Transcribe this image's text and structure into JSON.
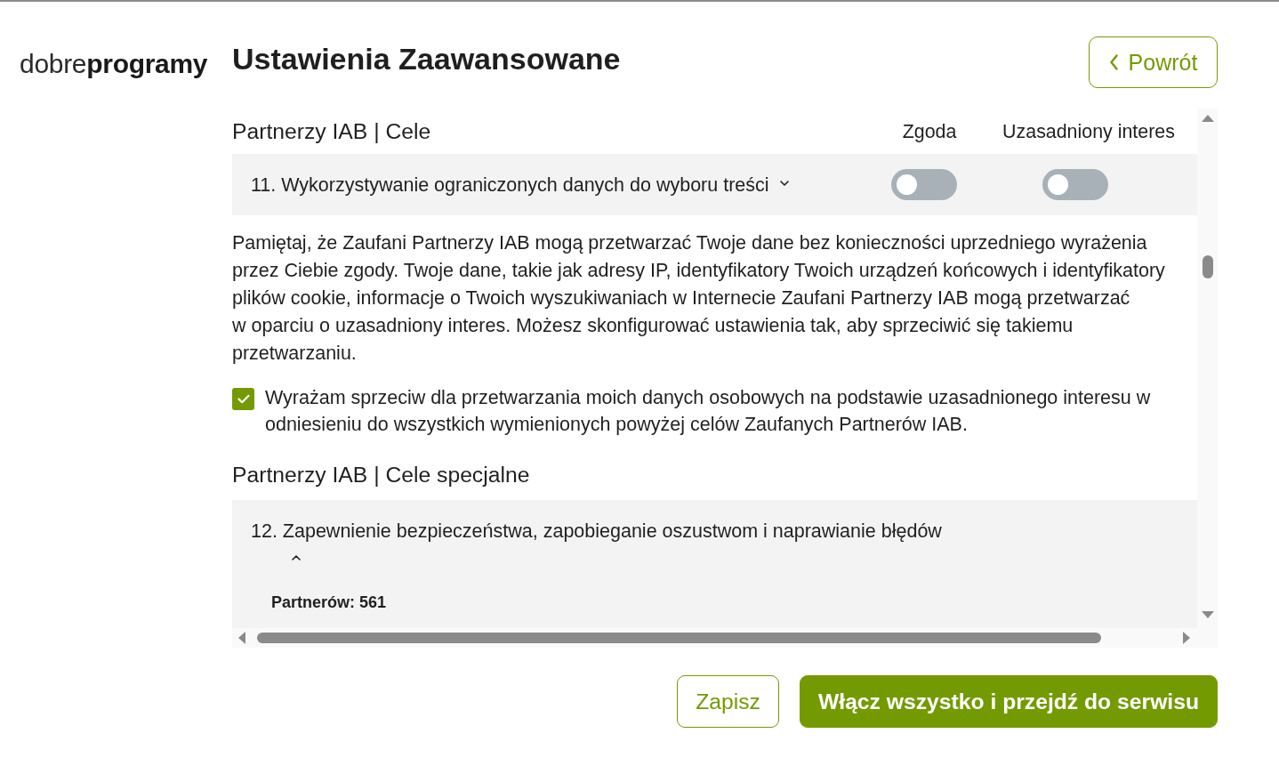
{
  "logo": "dobre**programy**",
  "title": "Ustawienia Zaawansowane",
  "back_button": {
    "label": "Powrót"
  },
  "purposes_section": {
    "heading": "Partnerzy IAB | Cele",
    "columns": [
      "Zgoda",
      "Uzasadniony interes"
    ],
    "items": [
      {
        "label": "11. Wykorzystywanie ograniczonych danych do wyboru treści",
        "expanded": false,
        "toggles": [
          {
            "on": false
          },
          {
            "on": false
          }
        ]
      }
    ]
  },
  "notice": "Pamiętaj, że Zaufani Partnerzy IAB mogą przetwarzać Twoje dane bez konieczności uprzedniego wyrażenia przez Ciebie zgody. Twoje dane, takie jak adresy IP, identyfikatory Twoich urządzeń końcowych i identyfikatory plików cookie, informacje o Twoich wyszukiwaniach w Internecie Zaufani Partnerzy IAB mogą przetwarzać w oparciu o uzasadniony interes. Możesz skonfigurować ustawienia tak, aby sprzeciwić się takiemu przetwarzaniu.",
  "objection_checkbox": {
    "label": "Wyrażam sprzeciw dla przetwarzania moich danych osobowych na podstawie uzasadnionego interesu w odniesieniu do wszystkich wymienionych powyżej celów Zaufanych Partnerów IAB.",
    "checked": true
  },
  "special_section": {
    "heading": "Partnerzy IAB | Cele specjalne",
    "items": [
      {
        "label": "12. Zapewnienie bezpieczeństwa, zapobieganie oszustwom i naprawianie błędów",
        "expanded": true,
        "partners": "Partnerów: 561"
      }
    ]
  },
  "buttons": [
    {
      "label": "Zapisz",
      "kind": "secondary"
    },
    {
      "label": "Włącz wszystko i przejdź do serwisu",
      "kind": "primary"
    }
  ]
}
